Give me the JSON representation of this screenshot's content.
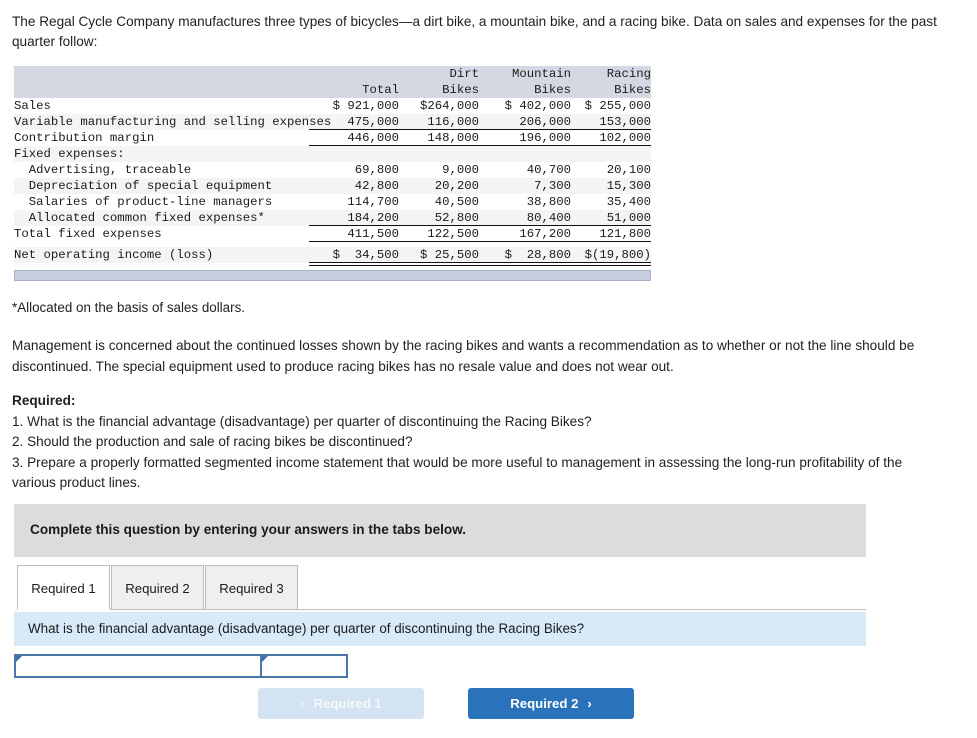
{
  "intro": {
    "text": "The Regal Cycle Company manufactures three types of bicycles—a dirt bike, a mountain bike, and a racing bike. Data on sales and expenses for the past quarter follow:"
  },
  "exhibit": {
    "columns": [
      {
        "line1": "",
        "line2": ""
      },
      {
        "line1": "",
        "line2": "Total"
      },
      {
        "line1": "Dirt",
        "line2": "Bikes"
      },
      {
        "line1": "Mountain",
        "line2": "Bikes"
      },
      {
        "line1": "Racing",
        "line2": "Bikes"
      }
    ],
    "rows": [
      {
        "label": "Sales",
        "cells": [
          "$ 921,000",
          "$264,000",
          "$ 402,000",
          "$ 255,000"
        ],
        "rule": "none"
      },
      {
        "label": "Variable manufacturing and selling expenses",
        "cells": [
          "475,000",
          "116,000",
          "206,000",
          "153,000"
        ],
        "rule": "single"
      },
      {
        "label": "Contribution margin",
        "cells": [
          "446,000",
          "148,000",
          "196,000",
          "102,000"
        ],
        "rule": "single"
      },
      {
        "label": "Fixed expenses:",
        "cells": [
          "",
          "",
          "",
          ""
        ],
        "rule": "none"
      },
      {
        "label": "  Advertising, traceable",
        "cells": [
          "69,800",
          "9,000",
          "40,700",
          "20,100"
        ],
        "rule": "none"
      },
      {
        "label": "  Depreciation of special equipment",
        "cells": [
          "42,800",
          "20,200",
          "7,300",
          "15,300"
        ],
        "rule": "none"
      },
      {
        "label": "  Salaries of product-line managers",
        "cells": [
          "114,700",
          "40,500",
          "38,800",
          "35,400"
        ],
        "rule": "none"
      },
      {
        "label": "  Allocated common fixed expenses*",
        "cells": [
          "184,200",
          "52,800",
          "80,400",
          "51,000"
        ],
        "rule": "single"
      },
      {
        "label": "Total fixed expenses",
        "cells": [
          "411,500",
          "122,500",
          "167,200",
          "121,800"
        ],
        "rule": "single"
      },
      {
        "label": "Net operating income (loss)",
        "cells": [
          "$  34,500",
          "$ 25,500",
          "$  28,800",
          "$(19,800)"
        ],
        "rule": "double"
      }
    ]
  },
  "footnote": {
    "text": "*Allocated on the basis of sales dollars."
  },
  "management": {
    "text": "Management is concerned about the continued losses shown by the racing bikes and wants a recommendation as to whether or not the line should be discontinued. The special equipment used to produce racing bikes has no resale value and does not wear out."
  },
  "required": {
    "title": "Required:",
    "items": [
      "1. What is the financial advantage (disadvantage) per quarter of discontinuing the Racing Bikes?",
      "2. Should the production and sale of racing bikes be discontinued?",
      "3. Prepare a properly formatted segmented income statement that would be more useful to management in assessing the long-run profitability of the various product lines."
    ]
  },
  "banner": {
    "text": "Complete this question by entering your answers in the tabs below."
  },
  "tabs": {
    "items": [
      {
        "label": "Required 1",
        "active": true
      },
      {
        "label": "Required 2",
        "active": false
      },
      {
        "label": "Required 3",
        "active": false
      }
    ]
  },
  "question": {
    "text": "What is the financial advantage (disadvantage) per quarter of discontinuing the Racing Bikes?"
  },
  "answer": {
    "cell_1_value": "",
    "cell_1_placeholder": "",
    "cell_2_value": "",
    "cell_2_placeholder": ""
  },
  "nav": {
    "prev_label": "Required 1",
    "next_label": "Required 2",
    "prev_chevron": "‹",
    "next_chevron": "›"
  },
  "colors": {
    "table_header_band": "#d3d8e3",
    "row_stripe": "#f4f4f4",
    "banner_grey": "#dcdcdc",
    "question_blue": "#d8eaf7",
    "next_button_blue": "#2a73bb",
    "prev_button_blue": "#d3e3f1",
    "input_border_blue": "#4a77ab",
    "scrollbar_track": "#c7cfdf"
  }
}
